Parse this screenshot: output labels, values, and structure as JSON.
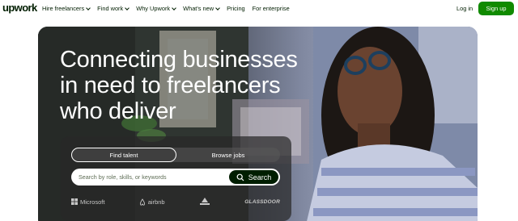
{
  "nav": {
    "logo": "upwork",
    "items": [
      {
        "label": "Hire freelancers",
        "has_dropdown": true
      },
      {
        "label": "Find work",
        "has_dropdown": true
      },
      {
        "label": "Why Upwork",
        "has_dropdown": true
      },
      {
        "label": "What's new",
        "has_dropdown": true
      },
      {
        "label": "Pricing",
        "has_dropdown": false
      },
      {
        "label": "For enterprise",
        "has_dropdown": false
      }
    ],
    "login": "Log in",
    "signup": "Sign up"
  },
  "hero": {
    "headline_lines": [
      "Connecting businesses",
      "in need to freelancers",
      "who deliver"
    ],
    "tabs": [
      {
        "label": "Find talent",
        "active": true
      },
      {
        "label": "Browse jobs",
        "active": false
      }
    ],
    "search": {
      "placeholder": "Search by role, skills, or keywords",
      "button": "Search"
    },
    "trusted_by": [
      {
        "name": "Microsoft",
        "icon": "microsoft-icon"
      },
      {
        "name": "airbnb",
        "icon": "airbnb-icon"
      },
      {
        "name": "",
        "icon": "bissell-icon"
      },
      {
        "name": "GLASSDOOR",
        "icon": ""
      }
    ]
  },
  "colors": {
    "brand_green": "#108a00",
    "dark": "#001e00"
  }
}
